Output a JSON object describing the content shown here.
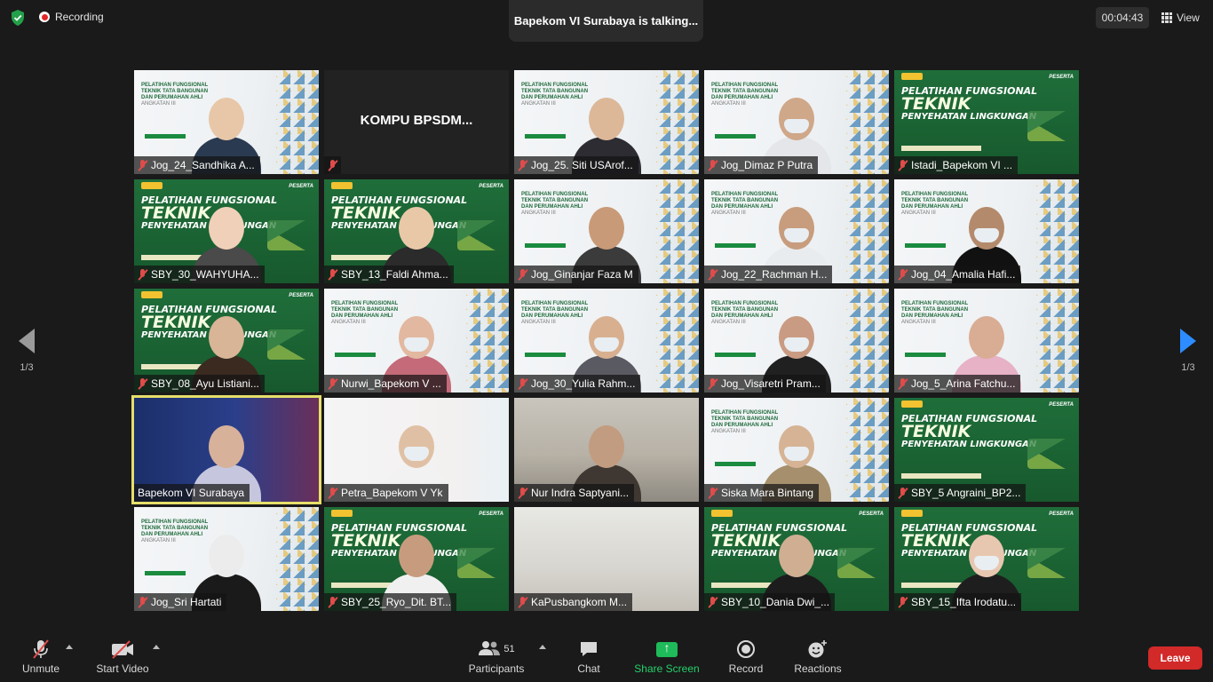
{
  "topbar": {
    "recording_label": "Recording",
    "talking_label": "Bapekom VI Surabaya is talking...",
    "timer": "00:04:43",
    "view_label": "View"
  },
  "pager": {
    "left": "1/3",
    "right": "1/3"
  },
  "tiles": [
    {
      "name": "Jog_24_Sandhika A...",
      "bg": "light",
      "muted": true,
      "person": true,
      "skin": "#e7c7a8",
      "cloth": "#2a3a50"
    },
    {
      "name": "",
      "bg": "dark",
      "muted": true,
      "center": "KOMPU  BPSDM...",
      "person": false
    },
    {
      "name": "Jog_25. Siti USArof...",
      "bg": "light",
      "muted": true,
      "person": true,
      "skin": "#dcb898",
      "cloth": "#2c2c32"
    },
    {
      "name": "Jog_Dimaz P Putra",
      "bg": "light",
      "muted": true,
      "person": true,
      "skin": "#cfa789",
      "cloth": "#e4e6ea",
      "mask": true
    },
    {
      "name": "Istadi_Bapekom VI ...",
      "bg": "green",
      "muted": true,
      "person": false
    },
    {
      "name": "SBY_30_WAHYUHA...",
      "bg": "green",
      "muted": true,
      "person": true,
      "skin": "#f0d0b8",
      "cloth": "#4a4a4a"
    },
    {
      "name": "SBY_13_Faldi Ahma...",
      "bg": "green",
      "muted": true,
      "person": true,
      "skin": "#e9c8a8",
      "cloth": "#2b2b2b"
    },
    {
      "name": "Jog_Ginanjar Faza M",
      "bg": "light",
      "muted": true,
      "person": true,
      "skin": "#c99a78",
      "cloth": "#3b3b3b"
    },
    {
      "name": "Jog_22_Rachman H...",
      "bg": "light",
      "muted": true,
      "person": true,
      "skin": "#c79d7d",
      "cloth": "#e9ecef",
      "mask": true
    },
    {
      "name": "Jog_04_Amalia Hafi...",
      "bg": "light",
      "muted": true,
      "person": true,
      "skin": "#b48a6c",
      "cloth": "#111111",
      "mask": true
    },
    {
      "name": "SBY_08_Ayu Listiani...",
      "bg": "green",
      "muted": true,
      "person": true,
      "skin": "#d7b596",
      "cloth": "#3a2a20"
    },
    {
      "name": "Nurwi_Bapekom V ...",
      "bg": "light",
      "muted": true,
      "person": true,
      "skin": "#e2b8a0",
      "cloth": "#c46a78",
      "mask": true
    },
    {
      "name": "Jog_30_Yulia Rahm...",
      "bg": "light",
      "muted": true,
      "person": true,
      "skin": "#d8b090",
      "cloth": "#5a5a62",
      "mask": true
    },
    {
      "name": "Jog_Visaretri Pram...",
      "bg": "light",
      "muted": true,
      "person": true,
      "skin": "#c99b82",
      "cloth": "#202020",
      "mask": true
    },
    {
      "name": "Jog_5_Arina Fatchu...",
      "bg": "light",
      "muted": true,
      "person": true,
      "skin": "#d9ad94",
      "cloth": "#e7b1c6"
    },
    {
      "name": "Bapekom VI Surabaya",
      "bg": "stage",
      "muted": false,
      "active": true,
      "person": true,
      "skin": "#d7b19a",
      "cloth": "#c6c7de"
    },
    {
      "name": "Petra_Bapekom V Yk",
      "bg": "bpsdm",
      "muted": true,
      "person": true,
      "skin": "#e0c0a4",
      "cloth": "#f2f2f2",
      "mask": true
    },
    {
      "name": "Nur Indra Saptyani...",
      "bg": "office",
      "muted": true,
      "person": true,
      "skin": "#c29c80",
      "cloth": "#3f3732"
    },
    {
      "name": "Siska Mara Bintang",
      "bg": "light",
      "muted": true,
      "person": true,
      "skin": "#d5b394",
      "cloth": "#a68f6c",
      "mask": true
    },
    {
      "name": "SBY_5 Angraini_BP2...",
      "bg": "green",
      "muted": true,
      "person": false
    },
    {
      "name": "Jog_Sri Hartati",
      "bg": "light",
      "muted": true,
      "person": true,
      "skin": "#ececec",
      "cloth": "#1a1a1a"
    },
    {
      "name": "SBY_25_Ryo_Dit. BT...",
      "bg": "green",
      "muted": true,
      "person": true,
      "skin": "#c79c7e",
      "cloth": "#f0f0f0"
    },
    {
      "name": "KaPusbangkom M...",
      "bg": "room",
      "muted": true,
      "person": false
    },
    {
      "name": "SBY_10_Dania Dwi_...",
      "bg": "green",
      "muted": true,
      "person": true,
      "skin": "#cfae92",
      "cloth": "#1c1c1c"
    },
    {
      "name": "SBY_15_Ifta Irodatu...",
      "bg": "green",
      "muted": true,
      "person": true,
      "skin": "#e8c7b0",
      "cloth": "#1e1e1e",
      "mask": true
    }
  ],
  "slide_light": {
    "l1": "PELATIHAN FUNGSIONAL",
    "l2": "TEKNIK TATA BANGUNAN",
    "l3": "DAN PERUMAHAN AHLI",
    "l4": "ANGKATAN III"
  },
  "slide_green": {
    "l1": "PELATIHAN FUNGSIONAL",
    "l2": "TEKNIK",
    "l3": "PENYEHATAN LINGKUNGAN",
    "peserta": "PESERTA"
  },
  "toolbar": {
    "unmute": "Unmute",
    "start_video": "Start Video",
    "participants": "Participants",
    "participants_count": "51",
    "chat": "Chat",
    "share_screen": "Share Screen",
    "record": "Record",
    "reactions": "Reactions",
    "leave": "Leave"
  }
}
